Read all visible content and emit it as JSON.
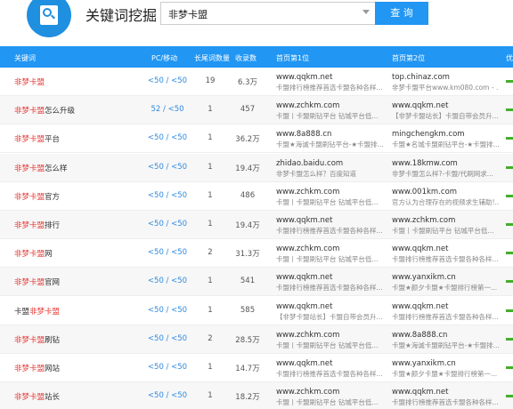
{
  "brand": "关键词挖掘",
  "search": {
    "value": "非梦卡盟",
    "button": "查 询"
  },
  "columns": {
    "keyword": "关键词",
    "pc_mobile": "PC/移动",
    "longtail": "长尾词数量",
    "indexed": "收录数",
    "first": "首页第1位",
    "second": "首页第2位",
    "extra": "优"
  },
  "rows": [
    {
      "kw_pre": "",
      "kw_hl": "非梦卡盟",
      "kw_post": "",
      "pc": "<50 / <50",
      "count": "19",
      "indexed": "6.3万",
      "s1_domain": "www.qqkm.net",
      "s1_title": "卡盟排行榜推荐首选卡盟各种各样...",
      "s2_domain": "top.chinaz.com",
      "s2_title": "非梦卡盟平台www.km080.com - ..."
    },
    {
      "kw_pre": "",
      "kw_hl": "非梦卡盟",
      "kw_post": "怎么升级",
      "pc": "52 / <50",
      "count": "1",
      "indexed": "457",
      "s1_domain": "www.zchkm.com",
      "s1_title": "卡盟丨卡盟刷钻平台 钻城平台低...",
      "s2_domain": "www.qqkm.net",
      "s2_title": "【非梦卡盟站长】卡盟自带会员升..."
    },
    {
      "kw_pre": "",
      "kw_hl": "非梦卡盟",
      "kw_post": "平台",
      "pc": "<50 / <50",
      "count": "1",
      "indexed": "36.2万",
      "s1_domain": "www.8a888.cn",
      "s1_title": "卡盟★海诚卡盟刷钻平台-★卡盟排...",
      "s2_domain": "mingchengkm.com",
      "s2_title": "卡盟★名城卡盟刷钻平台-★卡盟排..."
    },
    {
      "kw_pre": "",
      "kw_hl": "非梦卡盟",
      "kw_post": "怎么样",
      "pc": "<50 / <50",
      "count": "1",
      "indexed": "19.4万",
      "s1_domain": "zhidao.baidu.com",
      "s1_title": "非梦卡盟怎么样？百度知道",
      "s2_domain": "www.18kmw.com",
      "s2_title": "非梦卡盟怎么样?-卡盟/代刷网求..."
    },
    {
      "kw_pre": "",
      "kw_hl": "非梦卡盟",
      "kw_post": "官方",
      "pc": "<50 / <50",
      "count": "1",
      "indexed": "486",
      "s1_domain": "www.zchkm.com",
      "s1_title": "卡盟丨卡盟刷钻平台 钻城平台低...",
      "s2_domain": "www.001km.com",
      "s2_title": "官方认为合理存在的视频求生辅助!..."
    },
    {
      "kw_pre": "",
      "kw_hl": "非梦卡盟",
      "kw_post": "排行",
      "pc": "<50 / <50",
      "count": "1",
      "indexed": "19.4万",
      "s1_domain": "www.qqkm.net",
      "s1_title": "卡盟排行榜推荐首选卡盟各种各样...",
      "s2_domain": "www.zchkm.com",
      "s2_title": "卡盟丨卡盟刷钻平台 钻城平台低..."
    },
    {
      "kw_pre": "",
      "kw_hl": "非梦卡盟",
      "kw_post": "网",
      "pc": "<50 / <50",
      "count": "2",
      "indexed": "31.3万",
      "s1_domain": "www.zchkm.com",
      "s1_title": "卡盟丨卡盟刷钻平台 钻城平台低...",
      "s2_domain": "www.qqkm.net",
      "s2_title": "卡盟排行榜推荐首选卡盟各种各样..."
    },
    {
      "kw_pre": "",
      "kw_hl": "非梦卡盟",
      "kw_post": "官网",
      "pc": "<50 / <50",
      "count": "1",
      "indexed": "541",
      "s1_domain": "www.qqkm.net",
      "s1_title": "卡盟排行榜推荐首选卡盟各种各样...",
      "s2_domain": "www.yanxikm.cn",
      "s2_title": "卡盟★颜夕卡盟★卡盟排行榜第一..."
    },
    {
      "kw_pre": "卡盟",
      "kw_hl": "非梦卡盟",
      "kw_post": "",
      "pc": "<50 / <50",
      "count": "1",
      "indexed": "585",
      "s1_domain": "www.qqkm.net",
      "s1_title": "【非梦卡盟站长】卡盟自带会员升...",
      "s2_domain": "www.qqkm.net",
      "s2_title": "卡盟排行榜推荐首选卡盟各种各样..."
    },
    {
      "kw_pre": "",
      "kw_hl": "非梦卡盟",
      "kw_post": "刷钻",
      "pc": "<50 / <50",
      "count": "2",
      "indexed": "28.5万",
      "s1_domain": "www.zchkm.com",
      "s1_title": "卡盟丨卡盟刷钻平台 钻城平台低...",
      "s2_domain": "www.8a888.cn",
      "s2_title": "卡盟★海诚卡盟刷钻平台-★卡盟排..."
    },
    {
      "kw_pre": "",
      "kw_hl": "非梦卡盟",
      "kw_post": "网站",
      "pc": "<50 / <50",
      "count": "1",
      "indexed": "14.7万",
      "s1_domain": "www.qqkm.net",
      "s1_title": "卡盟排行榜推荐首选卡盟各种各样...",
      "s2_domain": "www.yanxikm.cn",
      "s2_title": "卡盟★颜夕卡盟★卡盟排行榜第一..."
    },
    {
      "kw_pre": "",
      "kw_hl": "非梦卡盟",
      "kw_post": "站长",
      "pc": "<50 / <50",
      "count": "1",
      "indexed": "18.2万",
      "s1_domain": "www.zchkm.com",
      "s1_title": "卡盟丨卡盟刷钻平台 钻城平台低...",
      "s2_domain": "www.qqkm.net",
      "s2_title": "卡盟排行榜推荐首选卡盟各种各样..."
    }
  ]
}
